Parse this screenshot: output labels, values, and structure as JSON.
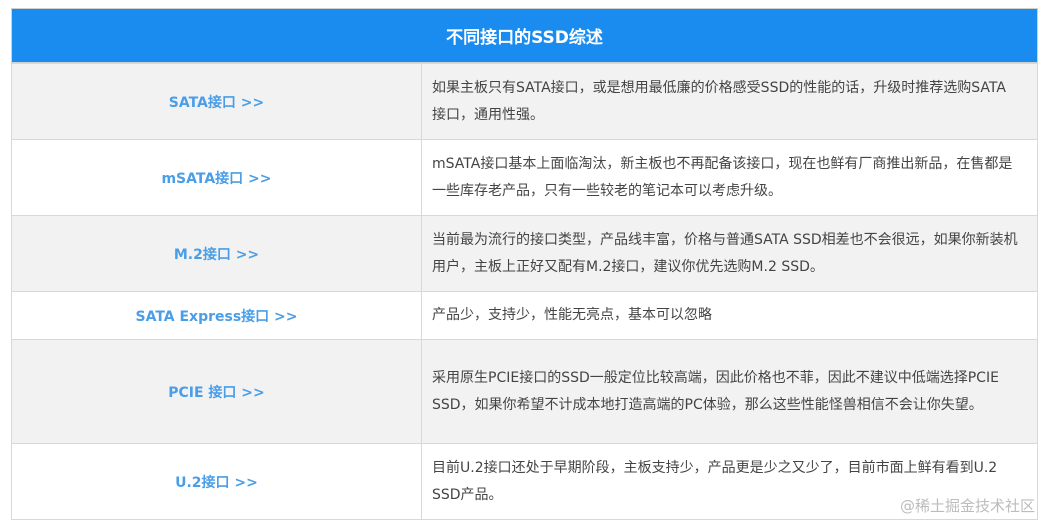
{
  "title": "不同接口的SSD综述",
  "rows": [
    {
      "key": "SATA接口 >>",
      "desc": "如果主板只有SATA接口，或是想用最低廉的价格感受SSD的性能的话，升级时推荐选购SATA接口，通用性强。"
    },
    {
      "key": "mSATA接口 >>",
      "desc": "mSATA接口基本上面临淘汰，新主板也不再配备该接口，现在也鲜有厂商推出新品，在售都是一些库存老产品，只有一些较老的笔记本可以考虑升级。"
    },
    {
      "key": "M.2接口 >>",
      "desc": "当前最为流行的接口类型，产品线丰富，价格与普通SATA SSD相差也不会很远，如果你新装机用户，主板上正好又配有M.2接口，建议你优先选购M.2 SSD。"
    },
    {
      "key": "SATA Express接口 >>",
      "desc": "产品少，支持少，性能无亮点，基本可以忽略"
    },
    {
      "key": "PCIE 接口 >>",
      "desc": "采用原生PCIE接口的SSD一般定位比较高端，因此价格也不菲，因此不建议中低端选择PCIE SSD，如果你希望不计成本地打造高端的PC体验，那么这些性能怪兽相信不会让你失望。"
    },
    {
      "key": "U.2接口 >>",
      "desc": "目前U.2接口还处于早期阶段，主板支持少，产品更是少之又少了，目前市面上鲜有看到U.2 SSD产品。"
    }
  ],
  "watermark": "@稀土掘金技术社区"
}
